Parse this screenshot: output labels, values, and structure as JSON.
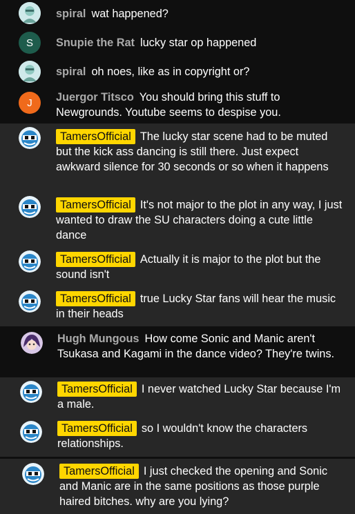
{
  "messages": [
    {
      "author": "spiral",
      "text": "wat happened?",
      "avatar_icon": "spiral-avatar-icon"
    },
    {
      "author": "Snupie the Rat",
      "text": "lucky star op happened",
      "avatar_letter": "S",
      "avatar_color": "#1e5c4c"
    },
    {
      "author": "spiral",
      "text": "oh noes, like as in copyright or?",
      "avatar_icon": "spiral-avatar-icon"
    },
    {
      "author": "Juergor Titsco",
      "text": "You should bring this stuff to Newgrounds. Youtube seems to despise you.",
      "avatar_letter": "J",
      "avatar_color": "#f06a1b"
    },
    {
      "author": "TamersOfficial",
      "text": "The lucky star scene had to be muted but the kick ass dancing is still there. Just expect awkward silence for 30 seconds or so when it happens",
      "avatar_icon": "sonic-avatar-icon"
    },
    {
      "author": "TamersOfficial",
      "text": "It's not major to the plot in any way, I just wanted to draw the SU characters doing a cute little dance",
      "avatar_icon": "sonic-avatar-icon"
    },
    {
      "author": "TamersOfficial",
      "text": "Actually it is major to the plot but the sound isn't",
      "avatar_icon": "sonic-avatar-icon"
    },
    {
      "author": "TamersOfficial",
      "text": "true Lucky Star fans will hear the music in their heads",
      "avatar_icon": "sonic-avatar-icon"
    },
    {
      "author": "Hugh Mungous",
      "text": "How come Sonic and Manic aren't Tsukasa and Kagami in the dance video? They're twins.",
      "avatar_icon": "anime-avatar-icon"
    },
    {
      "author": "TamersOfficial",
      "text": "I never watched Lucky Star because I'm a male.",
      "avatar_icon": "sonic-avatar-icon"
    },
    {
      "author": "TamersOfficial",
      "text": "so I wouldn't know the characters relationships.",
      "avatar_icon": "sonic-avatar-icon"
    },
    {
      "author": "TamersOfficial",
      "text": "I just checked the opening and Sonic and Manic are in the same positions as those purple haired bitches. why are you lying?",
      "avatar_icon": "sonic-avatar-icon"
    }
  ],
  "colors": {
    "background": "#0f0f0f",
    "highlight_background": "#272727",
    "owner_badge": "#ffd600",
    "author_name": "#aaaaaa",
    "message_text": "#ffffff"
  }
}
